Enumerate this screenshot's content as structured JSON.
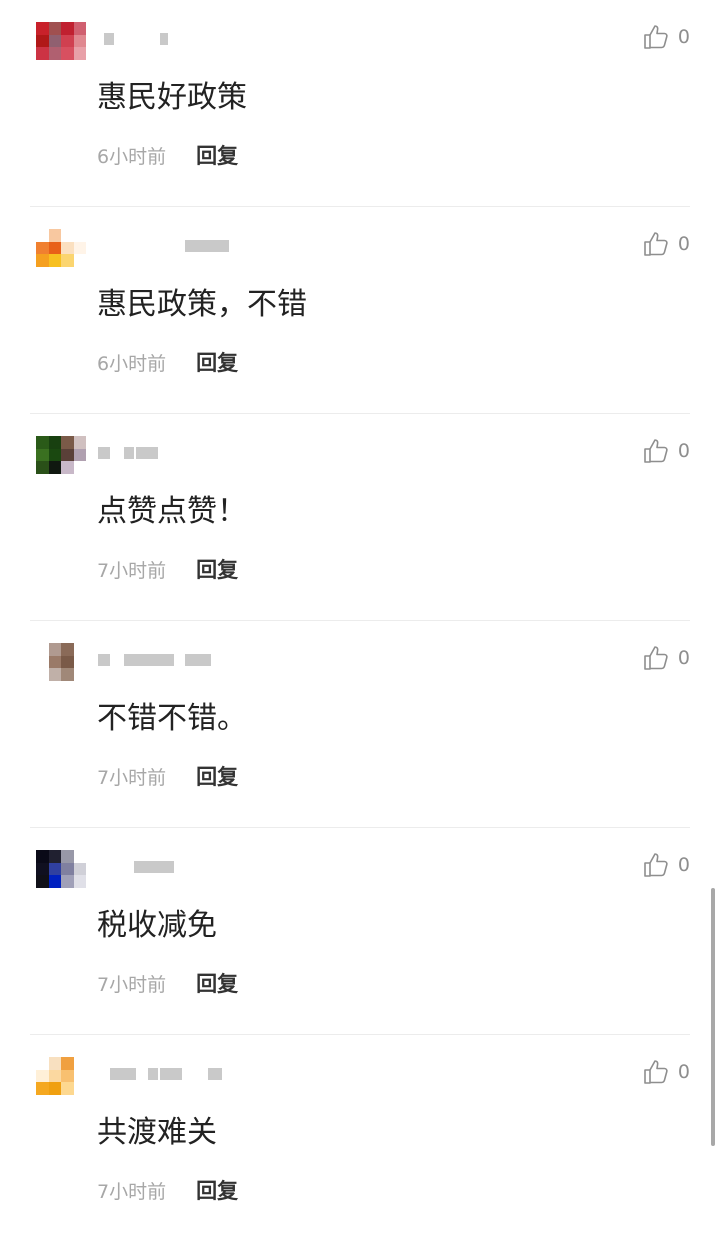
{
  "comments": [
    {
      "text": "惠民好政策",
      "time": "6小时前",
      "reply": "回复",
      "likes": "0",
      "avatar": [
        "#c8212a",
        "#a05050",
        "#c02030",
        "#d06070",
        "#b01818",
        "#906070",
        "#d04050",
        "#e08890",
        "#cc3344",
        "#b06070",
        "#d85060",
        "#e8a0a8"
      ]
    },
    {
      "text": "惠民政策，不错",
      "time": "6小时前",
      "reply": "回复",
      "likes": "0",
      "avatar": [
        "#ffffff",
        "#f8c8a0",
        "#ffffff",
        "#ffffff",
        "#f08030",
        "#e86018",
        "#fbe0c0",
        "#fff4e8",
        "#f5a020",
        "#f7c020",
        "#fbd570",
        "#ffffff"
      ]
    },
    {
      "text": "点赞点赞！",
      "time": "7小时前",
      "reply": "回复",
      "likes": "0",
      "avatar": [
        "#2a5a18",
        "#184010",
        "#7a5a48",
        "#d0c0c0",
        "#3a7020",
        "#1a4810",
        "#5a4038",
        "#b0a0b0",
        "#2a5018",
        "#101810",
        "#c8b8c8",
        "#ffffff"
      ]
    },
    {
      "text": "不错不错。",
      "time": "7小时前",
      "reply": "回复",
      "likes": "0",
      "avatar": [
        "#ffffff",
        "#b09a90",
        "#8a6a58",
        "#ffffff",
        "#ffffff",
        "#9a7a68",
        "#7a5a48",
        "#ffffff",
        "#ffffff",
        "#c0b0a8",
        "#a08878",
        "#ffffff"
      ]
    },
    {
      "text": "税收减免",
      "time": "7小时前",
      "reply": "回复",
      "likes": "0",
      "avatar": [
        "#0a0a18",
        "#202030",
        "#9898a8",
        "#ffffff",
        "#101020",
        "#3040a0",
        "#8080a0",
        "#d0d0d8",
        "#101018",
        "#0020c0",
        "#a0a0b8",
        "#e0e0e8"
      ]
    },
    {
      "text": "共渡难关",
      "time": "7小时前",
      "reply": "回复",
      "likes": "0",
      "avatar": [
        "#ffffff",
        "#f8e0c0",
        "#f0a040",
        "#ffffff",
        "#fff0d8",
        "#fbd8a0",
        "#f8c070",
        "#ffffff",
        "#f5a820",
        "#f0a010",
        "#fdd890",
        "#ffffff"
      ]
    }
  ]
}
